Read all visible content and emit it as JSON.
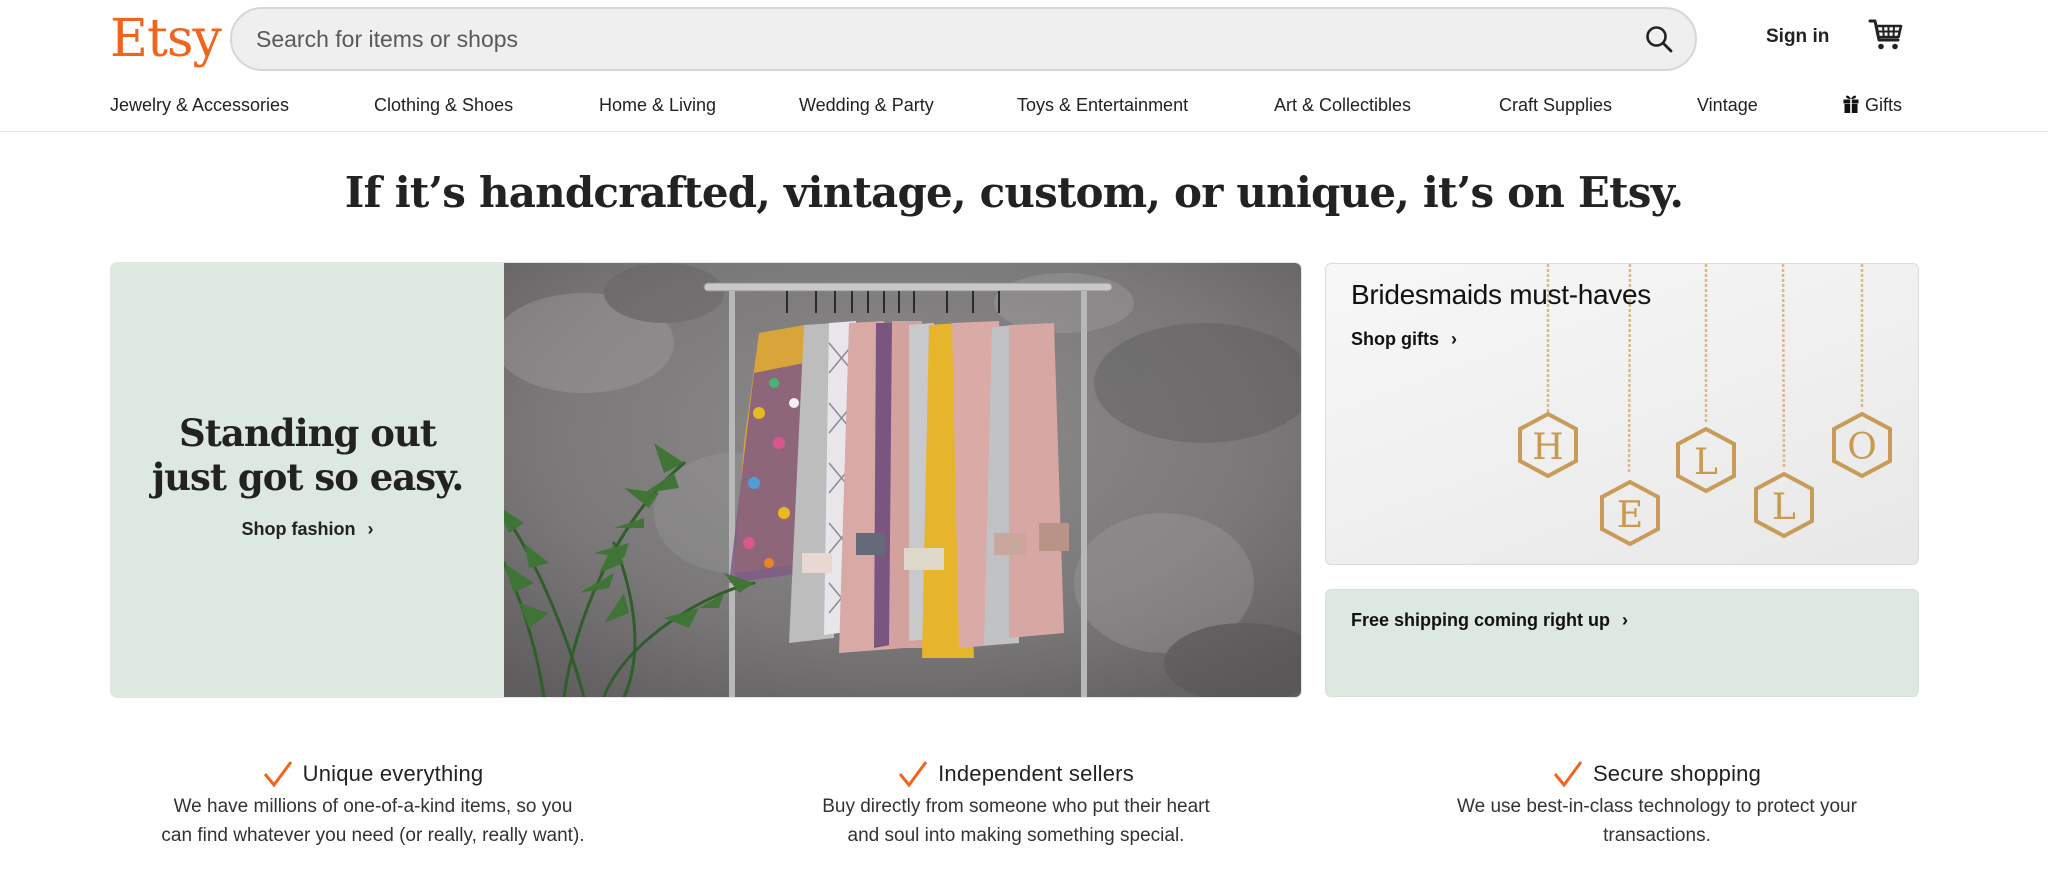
{
  "brand": {
    "logo_text": "Etsy",
    "accent_color": "#f1641e",
    "mint_color": "#dde8e0"
  },
  "header": {
    "search": {
      "placeholder": "Search for items or shops",
      "value": "",
      "icon": "search-icon"
    },
    "sign_in_label": "Sign in",
    "cart_icon": "cart-icon"
  },
  "nav": {
    "items": [
      {
        "label": "Jewelry & Accessories"
      },
      {
        "label": "Clothing & Shoes"
      },
      {
        "label": "Home & Living"
      },
      {
        "label": "Wedding & Party"
      },
      {
        "label": "Toys & Entertainment"
      },
      {
        "label": "Art & Collectibles"
      },
      {
        "label": "Craft Supplies"
      },
      {
        "label": "Vintage"
      },
      {
        "label": "Gifts",
        "icon": "gift-icon"
      }
    ]
  },
  "tagline": "If it’s handcrafted, vintage, custom, or unique, it’s on Etsy.",
  "hero": {
    "title": "Standing out just got so easy.",
    "link_label": "Shop fashion",
    "image_description": "Clothing rack with colorful raincoats against a grey concrete wall, palm plant in front"
  },
  "cards": {
    "gifts": {
      "title": "Bridesmaids must-haves",
      "link_label": "Shop gifts",
      "image_description": "Gold hexagon initial necklaces spelling H E L L O",
      "letters": [
        "H",
        "E",
        "L",
        "L",
        "O"
      ]
    },
    "shipping": {
      "link_label": "Free shipping coming right up"
    }
  },
  "features": [
    {
      "icon": "checkmark-icon",
      "title": "Unique everything",
      "description_lines": [
        "We have millions of one-of-a-kind items, so you",
        "can find whatever you need (or really, really want)."
      ]
    },
    {
      "icon": "checkmark-icon",
      "title": "Independent sellers",
      "description_lines": [
        "Buy directly from someone who put their heart",
        "and soul into making something special."
      ]
    },
    {
      "icon": "checkmark-icon",
      "title": "Secure shopping",
      "description_lines": [
        "We use best-in-class technology to protect your",
        "transactions."
      ]
    }
  ]
}
